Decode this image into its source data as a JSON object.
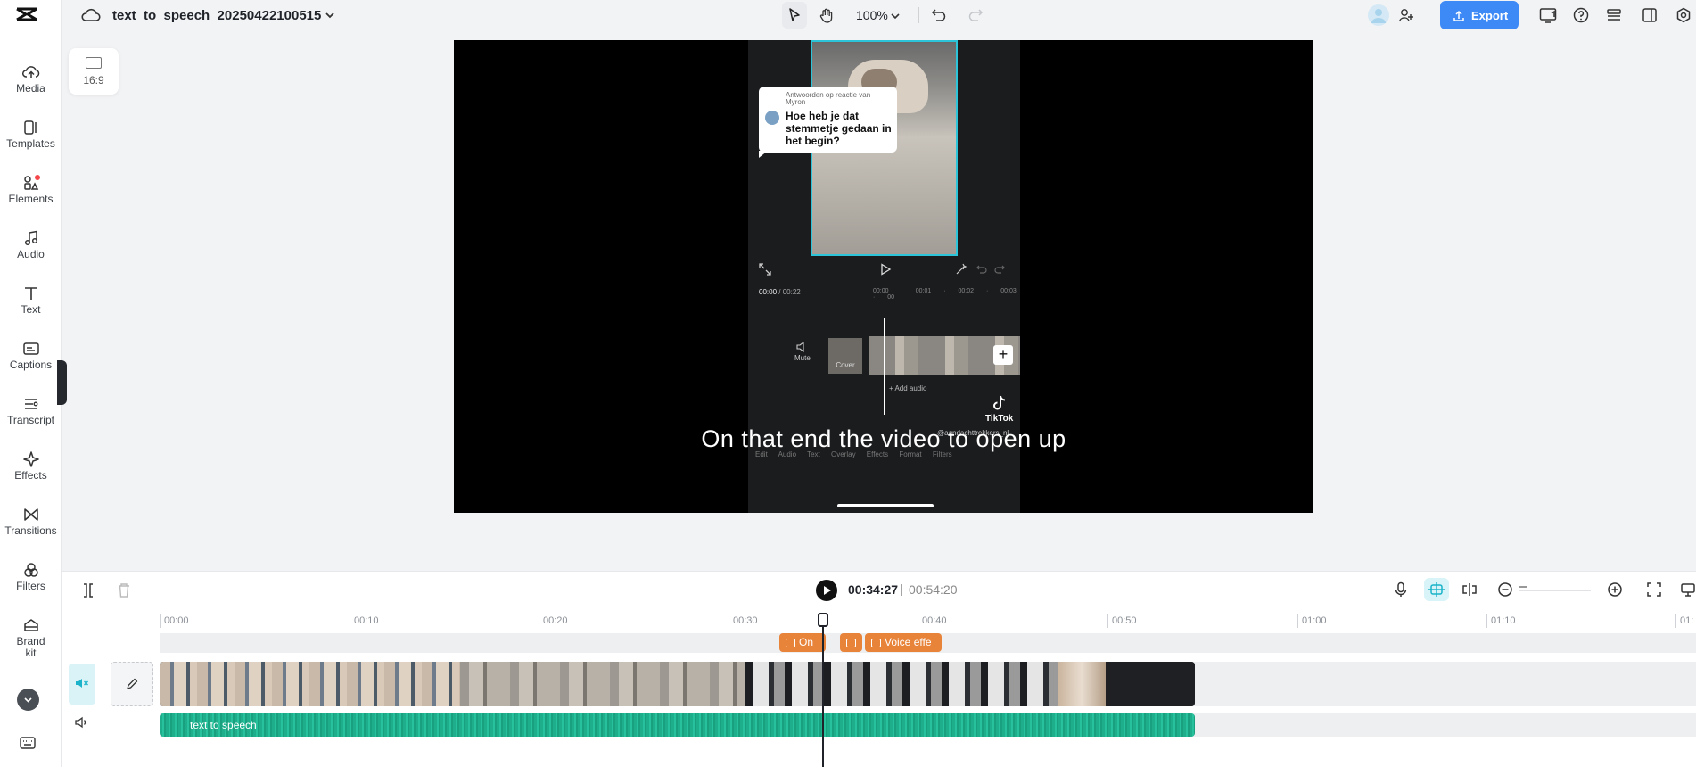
{
  "app": {
    "project_name": "text_to_speech_20250422100515",
    "zoom_level": "100%",
    "export_label": "Export"
  },
  "sidebar": {
    "items": [
      {
        "label": "Media",
        "icon": "cloud-upload-icon"
      },
      {
        "label": "Templates",
        "icon": "templates-icon"
      },
      {
        "label": "Elements",
        "icon": "elements-icon",
        "badge": true
      },
      {
        "label": "Audio",
        "icon": "music-note-icon"
      },
      {
        "label": "Text",
        "icon": "text-icon"
      },
      {
        "label": "Captions",
        "icon": "captions-icon"
      },
      {
        "label": "Transcript",
        "icon": "transcript-icon"
      },
      {
        "label": "Effects",
        "icon": "sparkle-icon"
      },
      {
        "label": "Transitions",
        "icon": "transitions-icon"
      },
      {
        "label": "Filters",
        "icon": "filters-icon"
      },
      {
        "label": "Brand\nkit",
        "icon": "brand-kit-icon"
      }
    ]
  },
  "canvas": {
    "aspect_ratio": "16:9",
    "subtitle": "On that end the video to open up",
    "phone": {
      "bubble_header": "Antwoorden op reactie van Myron",
      "bubble_text": "Hoe heb je dat stemmetje gedaan in het begin?",
      "time_current": "00:00",
      "time_total": "/ 00:22",
      "ticks": "00:00 · 00:01 · 00:02 · 00:03 · 00",
      "mute_label": "Mute",
      "cover_label": "Cover",
      "add_audio": "+ Add audio",
      "tiktok": "TikTok",
      "nickname": "@aandachttrekkers_nl",
      "tools": "Edit Audio Text Overlay Effects Format Filters"
    }
  },
  "timeline": {
    "current_time": "00:34:27",
    "separator": "|",
    "total_time": "00:54:20",
    "ruler": [
      "00:00",
      "00:10",
      "00:20",
      "00:30",
      "00:40",
      "00:50",
      "01:00",
      "01:10",
      "01:"
    ],
    "markers": [
      {
        "label": "On"
      },
      {
        "label": ""
      },
      {
        "label": "Voice effe"
      }
    ],
    "audio_clip_label": "text to speech"
  },
  "colors": {
    "accent": "#3d8af7",
    "audio_clip": "#1fae8c",
    "marker": "#e8833a",
    "active_tool": "#d8f4f8"
  }
}
